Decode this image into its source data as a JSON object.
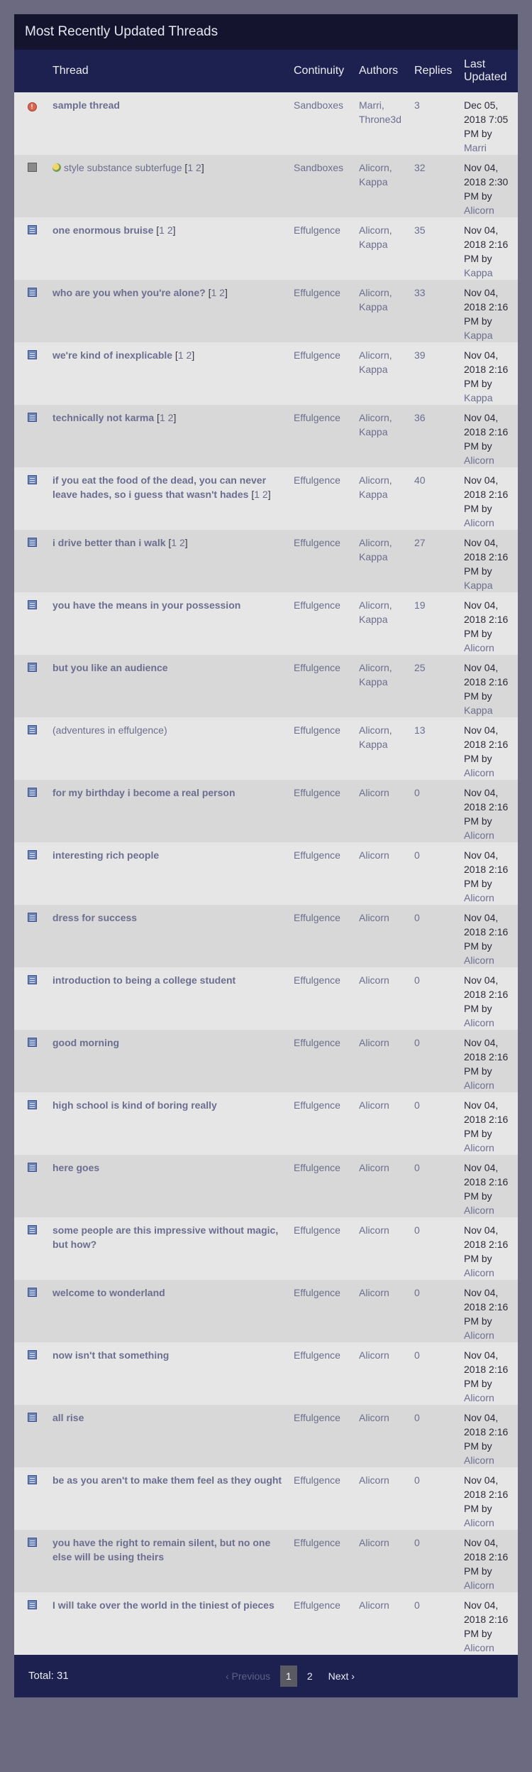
{
  "title": "Most Recently Updated Threads",
  "columns": {
    "thread": "Thread",
    "continuity": "Continuity",
    "authors": "Authors",
    "replies": "Replies",
    "last_updated": "Last Updated"
  },
  "threads": [
    {
      "icon": "alert-icon",
      "title": "sample thread",
      "bold": true,
      "pages": [],
      "continuity": "Sandboxes",
      "authors": [
        "Marri",
        "Throne3d"
      ],
      "replies": "3",
      "date": "Dec 05, 2018 7:05 PM",
      "by": "Marri"
    },
    {
      "icon": "gray-post-icon",
      "title": "style substance subterfuge",
      "bold": false,
      "sub_icon": true,
      "pages": [
        "1",
        "2"
      ],
      "continuity": "Sandboxes",
      "authors": [
        "Alicorn",
        "Kappa"
      ],
      "replies": "32",
      "date": "Nov 04, 2018 2:30 PM",
      "by": "Alicorn"
    },
    {
      "icon": "post-icon",
      "title": "one enormous bruise",
      "bold": true,
      "pages": [
        "1",
        "2"
      ],
      "continuity": "Effulgence",
      "authors": [
        "Alicorn",
        "Kappa"
      ],
      "replies": "35",
      "date": "Nov 04, 2018 2:16 PM",
      "by": "Kappa"
    },
    {
      "icon": "post-icon",
      "title": "who are you when you're alone?",
      "bold": true,
      "pages": [
        "1",
        "2"
      ],
      "continuity": "Effulgence",
      "authors": [
        "Alicorn",
        "Kappa"
      ],
      "replies": "33",
      "date": "Nov 04, 2018 2:16 PM",
      "by": "Kappa"
    },
    {
      "icon": "post-icon",
      "title": "we're kind of inexplicable",
      "bold": true,
      "pages": [
        "1",
        "2"
      ],
      "continuity": "Effulgence",
      "authors": [
        "Alicorn",
        "Kappa"
      ],
      "replies": "39",
      "date": "Nov 04, 2018 2:16 PM",
      "by": "Kappa"
    },
    {
      "icon": "post-icon",
      "title": "technically not karma",
      "bold": true,
      "pages": [
        "1",
        "2"
      ],
      "continuity": "Effulgence",
      "authors": [
        "Alicorn",
        "Kappa"
      ],
      "replies": "36",
      "date": "Nov 04, 2018 2:16 PM",
      "by": "Alicorn"
    },
    {
      "icon": "post-icon",
      "title": "if you eat the food of the dead, you can never leave hades, so i guess that wasn't hades",
      "bold": true,
      "pages": [
        "1",
        "2"
      ],
      "continuity": "Effulgence",
      "authors": [
        "Alicorn",
        "Kappa"
      ],
      "replies": "40",
      "date": "Nov 04, 2018 2:16 PM",
      "by": "Alicorn"
    },
    {
      "icon": "post-icon",
      "title": "i drive better than i walk",
      "bold": true,
      "pages": [
        "1",
        "2"
      ],
      "continuity": "Effulgence",
      "authors": [
        "Alicorn",
        "Kappa"
      ],
      "replies": "27",
      "date": "Nov 04, 2018 2:16 PM",
      "by": "Kappa"
    },
    {
      "icon": "post-icon",
      "title": "you have the means in your possession",
      "bold": true,
      "pages": [],
      "continuity": "Effulgence",
      "authors": [
        "Alicorn",
        "Kappa"
      ],
      "replies": "19",
      "date": "Nov 04, 2018 2:16 PM",
      "by": "Alicorn"
    },
    {
      "icon": "post-icon",
      "title": "but you like an audience",
      "bold": true,
      "pages": [],
      "continuity": "Effulgence",
      "authors": [
        "Alicorn",
        "Kappa"
      ],
      "replies": "25",
      "date": "Nov 04, 2018 2:16 PM",
      "by": "Kappa"
    },
    {
      "icon": "post-icon",
      "title": "(adventures in effulgence)",
      "bold": false,
      "pages": [],
      "continuity": "Effulgence",
      "authors": [
        "Alicorn",
        "Kappa"
      ],
      "replies": "13",
      "date": "Nov 04, 2018 2:16 PM",
      "by": "Alicorn"
    },
    {
      "icon": "post-icon",
      "title": "for my birthday i become a real person",
      "bold": true,
      "pages": [],
      "continuity": "Effulgence",
      "authors": [
        "Alicorn"
      ],
      "replies": "0",
      "date": "Nov 04, 2018 2:16 PM",
      "by": "Alicorn"
    },
    {
      "icon": "post-icon",
      "title": "interesting rich people",
      "bold": true,
      "pages": [],
      "continuity": "Effulgence",
      "authors": [
        "Alicorn"
      ],
      "replies": "0",
      "date": "Nov 04, 2018 2:16 PM",
      "by": "Alicorn"
    },
    {
      "icon": "post-icon",
      "title": "dress for success",
      "bold": true,
      "pages": [],
      "continuity": "Effulgence",
      "authors": [
        "Alicorn"
      ],
      "replies": "0",
      "date": "Nov 04, 2018 2:16 PM",
      "by": "Alicorn"
    },
    {
      "icon": "post-icon",
      "title": "introduction to being a college student",
      "bold": true,
      "pages": [],
      "continuity": "Effulgence",
      "authors": [
        "Alicorn"
      ],
      "replies": "0",
      "date": "Nov 04, 2018 2:16 PM",
      "by": "Alicorn"
    },
    {
      "icon": "post-icon",
      "title": "good morning",
      "bold": true,
      "pages": [],
      "continuity": "Effulgence",
      "authors": [
        "Alicorn"
      ],
      "replies": "0",
      "date": "Nov 04, 2018 2:16 PM",
      "by": "Alicorn"
    },
    {
      "icon": "post-icon",
      "title": "high school is kind of boring really",
      "bold": true,
      "pages": [],
      "continuity": "Effulgence",
      "authors": [
        "Alicorn"
      ],
      "replies": "0",
      "date": "Nov 04, 2018 2:16 PM",
      "by": "Alicorn"
    },
    {
      "icon": "post-icon",
      "title": "here goes",
      "bold": true,
      "pages": [],
      "continuity": "Effulgence",
      "authors": [
        "Alicorn"
      ],
      "replies": "0",
      "date": "Nov 04, 2018 2:16 PM",
      "by": "Alicorn"
    },
    {
      "icon": "post-icon",
      "title": "some people are this impressive without magic, but how?",
      "bold": true,
      "pages": [],
      "continuity": "Effulgence",
      "authors": [
        "Alicorn"
      ],
      "replies": "0",
      "date": "Nov 04, 2018 2:16 PM",
      "by": "Alicorn"
    },
    {
      "icon": "post-icon",
      "title": "welcome to wonderland",
      "bold": true,
      "pages": [],
      "continuity": "Effulgence",
      "authors": [
        "Alicorn"
      ],
      "replies": "0",
      "date": "Nov 04, 2018 2:16 PM",
      "by": "Alicorn"
    },
    {
      "icon": "post-icon",
      "title": "now isn't that something",
      "bold": true,
      "pages": [],
      "continuity": "Effulgence",
      "authors": [
        "Alicorn"
      ],
      "replies": "0",
      "date": "Nov 04, 2018 2:16 PM",
      "by": "Alicorn"
    },
    {
      "icon": "post-icon",
      "title": "all rise",
      "bold": true,
      "pages": [],
      "continuity": "Effulgence",
      "authors": [
        "Alicorn"
      ],
      "replies": "0",
      "date": "Nov 04, 2018 2:16 PM",
      "by": "Alicorn"
    },
    {
      "icon": "post-icon",
      "title": "be as you aren't to make them feel as they ought",
      "bold": true,
      "pages": [],
      "continuity": "Effulgence",
      "authors": [
        "Alicorn"
      ],
      "replies": "0",
      "date": "Nov 04, 2018 2:16 PM",
      "by": "Alicorn"
    },
    {
      "icon": "post-icon",
      "title": "you have the right to remain silent, but no one else will be using theirs",
      "bold": true,
      "pages": [],
      "continuity": "Effulgence",
      "authors": [
        "Alicorn"
      ],
      "replies": "0",
      "date": "Nov 04, 2018 2:16 PM",
      "by": "Alicorn"
    },
    {
      "icon": "post-icon",
      "title": "I will take over the world in the tiniest of pieces",
      "bold": true,
      "pages": [],
      "continuity": "Effulgence",
      "authors": [
        "Alicorn"
      ],
      "replies": "0",
      "date": "Nov 04, 2018 2:16 PM",
      "by": "Alicorn"
    }
  ],
  "by_label": "by",
  "footer": {
    "total": "Total: 31",
    "prev": "‹ Previous",
    "page1": "1",
    "page2": "2",
    "next": "Next ›"
  }
}
